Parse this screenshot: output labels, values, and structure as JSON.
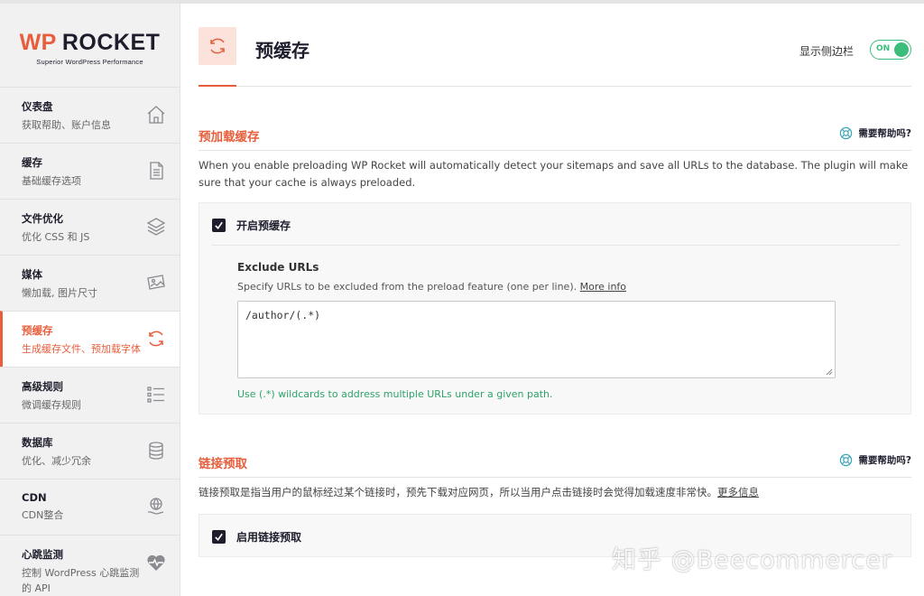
{
  "brand": {
    "wp": "WP",
    "rocket": "ROCKET",
    "tagline": "Superior WordPress Performance",
    "accent_color": "#e85d3b",
    "dark_color": "#1d1d2c"
  },
  "sidebar": {
    "items": [
      {
        "title": "仪表盘",
        "subtitle": "获取帮助、账户信息",
        "icon": "home-icon"
      },
      {
        "title": "缓存",
        "subtitle": "基础缓存选项",
        "icon": "file-icon"
      },
      {
        "title": "文件优化",
        "subtitle": "优化 CSS 和 JS",
        "icon": "layers-icon"
      },
      {
        "title": "媒体",
        "subtitle": "懒加载, 图片尺寸",
        "icon": "image-icon"
      },
      {
        "title": "预缓存",
        "subtitle": "生成缓存文件、预加载字体",
        "icon": "refresh-icon",
        "active": true
      },
      {
        "title": "高级规则",
        "subtitle": "微调缓存规则",
        "icon": "list-icon"
      },
      {
        "title": "数据库",
        "subtitle": "优化、减少冗余",
        "icon": "database-icon"
      },
      {
        "title": "CDN",
        "subtitle": "CDN整合",
        "icon": "globe-hand-icon"
      },
      {
        "title": "心跳监测",
        "subtitle_line1": "控制 WordPress 心跳监测",
        "subtitle_line2": "的 API",
        "icon": "heartbeat-icon"
      }
    ]
  },
  "header": {
    "title": "预缓存",
    "sidebar_toggle_label": "显示侧边栏",
    "toggle_state": "ON"
  },
  "preload": {
    "section_title": "预加载缓存",
    "help_label": "需要帮助吗?",
    "description": "When you enable preloading WP Rocket will automatically detect your sitemaps and save all URLs to the database. The plugin will make sure that your cache is always preloaded.",
    "checkbox_label": "开启预缓存",
    "checked": true,
    "exclude_label": "Exclude URLs",
    "exclude_desc": "Specify URLs to be excluded from the preload feature (one per line).",
    "more_info": "More info",
    "textarea_value": "/author/(.*)",
    "hint": "Use (.*) wildcards to address multiple URLs under a given path."
  },
  "link_prefetch": {
    "section_title": "链接预取",
    "help_label": "需要帮助吗?",
    "description": "链接预取是指当用户的鼠标经过某个链接时，预先下载对应网页，所以当用户点击链接时会觉得加载速度非常快。",
    "more_info": "更多信息",
    "checkbox_label": "启用链接预取",
    "checked": true
  },
  "watermark": "知乎 @Beecommercer"
}
